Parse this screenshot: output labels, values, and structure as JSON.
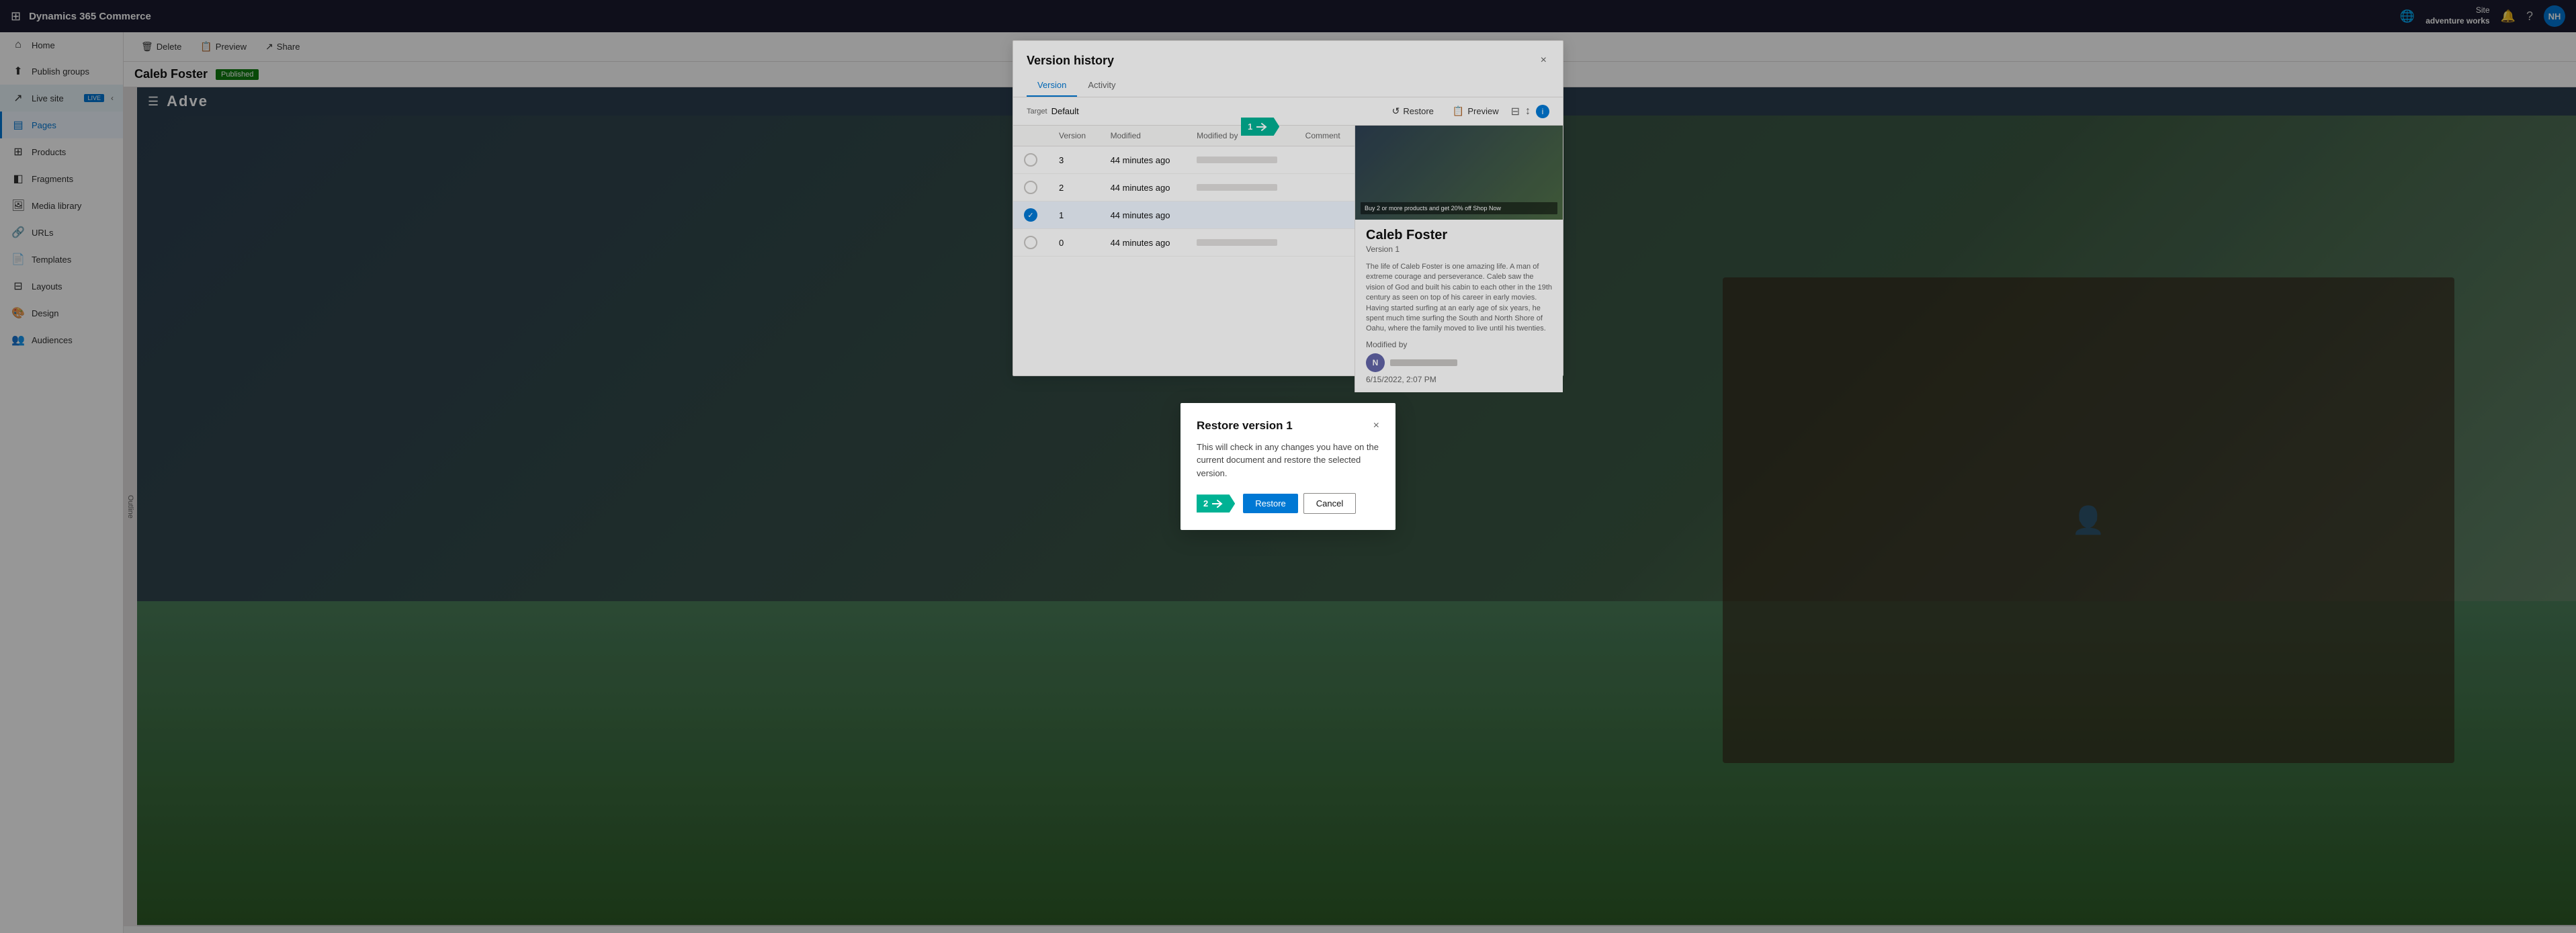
{
  "app": {
    "title": "Dynamics 365 Commerce"
  },
  "topnav": {
    "title": "Dynamics 365 Commerce",
    "site_label": "Site",
    "site_name": "adventure works",
    "avatar_initials": "NH",
    "icons": {
      "grid": "⊞",
      "globe": "🌐",
      "bell": "🔔",
      "help": "?"
    }
  },
  "sidebar": {
    "items": [
      {
        "id": "home",
        "label": "Home",
        "icon": "⌂"
      },
      {
        "id": "publish-groups",
        "label": "Publish groups",
        "icon": "↑"
      },
      {
        "id": "live-site",
        "label": "Live site",
        "icon": "↗",
        "badge": "LIVE",
        "active": false
      },
      {
        "id": "pages",
        "label": "Pages",
        "icon": "▤",
        "active": true
      },
      {
        "id": "products",
        "label": "Products",
        "icon": "⊞"
      },
      {
        "id": "fragments",
        "label": "Fragments",
        "icon": "◧"
      },
      {
        "id": "media-library",
        "label": "Media library",
        "icon": "🖼"
      },
      {
        "id": "urls",
        "label": "URLs",
        "icon": "🔗"
      },
      {
        "id": "templates",
        "label": "Templates",
        "icon": "📄"
      },
      {
        "id": "layouts",
        "label": "Layouts",
        "icon": "⊞"
      },
      {
        "id": "design",
        "label": "Design",
        "icon": "🎨"
      },
      {
        "id": "audiences",
        "label": "Audiences",
        "icon": "👥"
      }
    ]
  },
  "toolbar": {
    "delete_label": "Delete",
    "preview_label": "Preview",
    "share_label": "Share"
  },
  "page_header": {
    "title": "Caleb Foster",
    "status": "Published"
  },
  "outline": {
    "label": "Outline"
  },
  "version_panel": {
    "title": "Version history",
    "close_label": "×",
    "tabs": [
      {
        "id": "version",
        "label": "Version",
        "active": true
      },
      {
        "id": "activity",
        "label": "Activity",
        "active": false
      }
    ],
    "target_label": "Target",
    "target_value": "Default",
    "actions": {
      "restore_label": "Restore",
      "preview_label": "Preview"
    },
    "table": {
      "columns": [
        "Version",
        "Modified",
        "Modified by",
        "Comment"
      ],
      "rows": [
        {
          "version": "3",
          "modified": "44 minutes ago",
          "modified_by_placeholder": true,
          "comment": "",
          "selected": false
        },
        {
          "version": "2",
          "modified": "44 minutes ago",
          "modified_by_placeholder": true,
          "comment": "",
          "selected": false
        },
        {
          "version": "1",
          "modified": "44 minutes ago",
          "modified_by": "",
          "comment": "",
          "selected": true
        },
        {
          "version": "0",
          "modified": "44 minutes ago",
          "modified_by_placeholder": true,
          "comment": "",
          "selected": false
        }
      ]
    }
  },
  "side_panel": {
    "name": "Caleb Foster",
    "version": "Version 1",
    "modified_by_label": "Modified by",
    "avatar_initials": "N",
    "date": "6/15/2022, 2:07 PM"
  },
  "restore_dialog": {
    "title": "Restore version 1",
    "body": "This will check in any changes you have on the current document and restore the selected version.",
    "restore_label": "Restore",
    "cancel_label": "Cancel"
  },
  "step_arrows": {
    "arrow1": {
      "number": "1"
    },
    "arrow2": {
      "number": "2"
    }
  }
}
